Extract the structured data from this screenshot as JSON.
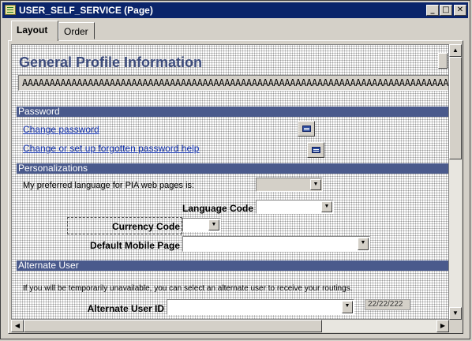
{
  "window": {
    "title": "USER_SELF_SERVICE (Page)",
    "buttons": {
      "minimize": "_",
      "maximize": "□",
      "close": "✕"
    }
  },
  "tabs": [
    {
      "label": "Layout",
      "active": true
    },
    {
      "label": "Order",
      "active": false
    }
  ],
  "page": {
    "heading": "General Profile Information",
    "long_field": "AAAAAAAAAAAAAAAAAAAAAAAAAAAAAAAAAAAAAAAAAAAAAAAAAAAAAAAAAAAAAAAAAAAAAAAAAAAAAAAA",
    "sections": {
      "password": "Password",
      "personalizations": "Personalizations",
      "alternate_user": "Alternate User"
    },
    "links": {
      "change_password": "Change password",
      "forgotten_password": "Change or set up forgotten password help"
    },
    "language_prompt": "My preferred language for PIA web pages is:",
    "labels": {
      "language_code": "Language Code",
      "currency_code": "Currency Code",
      "default_mobile_page": "Default Mobile Page",
      "alternate_user_id": "Alternate User ID"
    },
    "alternate_user_text": "If you will be temporarily unavailable, you can select an alternate user to receive your routings.",
    "date_value": "22/22/222"
  },
  "icons": {
    "window_icon": "page-icon",
    "lookup": "prompt-list-icon",
    "dropdown": "down-arrow-icon",
    "scroll_up": "up-arrow-icon",
    "scroll_down": "down-arrow-icon",
    "scroll_left": "left-arrow-icon",
    "scroll_right": "right-arrow-icon"
  },
  "colors": {
    "title_bar": "#0a246a",
    "section_bar": "#4a5a8c",
    "heading_text": "#3d4c7c",
    "link_text": "#1030b0"
  }
}
